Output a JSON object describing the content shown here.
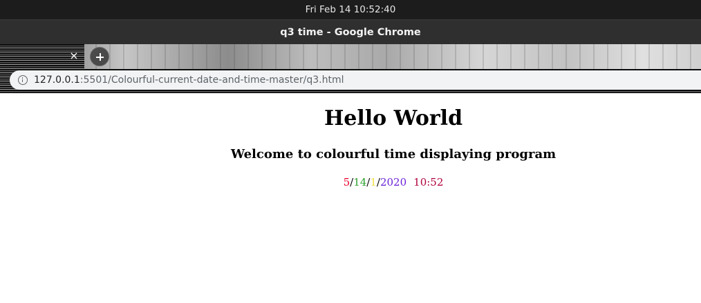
{
  "system": {
    "clock": "Fri Feb 14  10:52:40"
  },
  "window": {
    "title": "q3 time - Google Chrome"
  },
  "tab": {
    "close_glyph": "×"
  },
  "address_bar": {
    "host": "127.0.0.1",
    "path": ":5501/Colourful-current-date-and-time-master/q3.html"
  },
  "page": {
    "heading": "Hello World",
    "subheading": "Welcome to colourful time displaying program",
    "datetime": {
      "month": "5",
      "day": "14",
      "weekday_num": "1",
      "year": "2020",
      "time": "10:52",
      "separator": "/"
    }
  },
  "colors": {
    "month": "#e8002a",
    "day": "#2ca02c",
    "weekday_num": "#f0e040",
    "year": "#6a1fd8",
    "time": "#b0003a"
  }
}
